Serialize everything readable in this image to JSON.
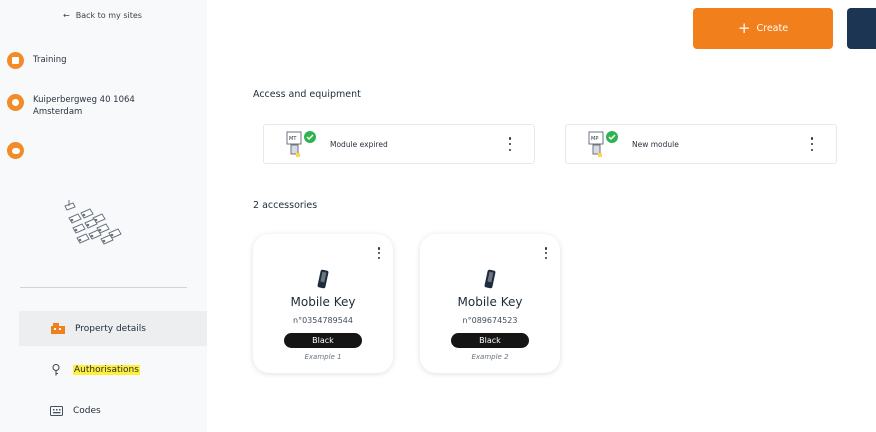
{
  "sidebar": {
    "back_label": "Back to my sites",
    "site_name": "Training",
    "address": "Kuiperbergweg 40 1064 Amsterdam",
    "comment": "",
    "menu": [
      {
        "label": "Property details",
        "icon": "building-icon",
        "active": true
      },
      {
        "label": "Authorisations",
        "icon": "key-icon",
        "highlighted": true
      },
      {
        "label": "Codes",
        "icon": "keypad-icon"
      }
    ]
  },
  "header": {
    "create_label": "Create",
    "create_icon": "plus-icon"
  },
  "sections": {
    "access_title": "Access and equipment",
    "accessories_title": "2 accessories"
  },
  "modules": [
    {
      "label": "Module expired",
      "icon": "module-icon",
      "status": "check"
    },
    {
      "label": "New module",
      "icon": "module-icon",
      "status": "check"
    }
  ],
  "accessories": [
    {
      "title": "Mobile Key",
      "serial": "n°0354789544",
      "color": "Black",
      "example": "Example 1"
    },
    {
      "title": "Mobile Key",
      "serial": "n°089674523",
      "color": "Black",
      "example": "Example 2"
    }
  ],
  "colors": {
    "accent_orange": "#f07f1c",
    "dark_navy": "#1c3553",
    "success_green": "#2fb351",
    "highlight_yellow": "#ffee3a"
  }
}
